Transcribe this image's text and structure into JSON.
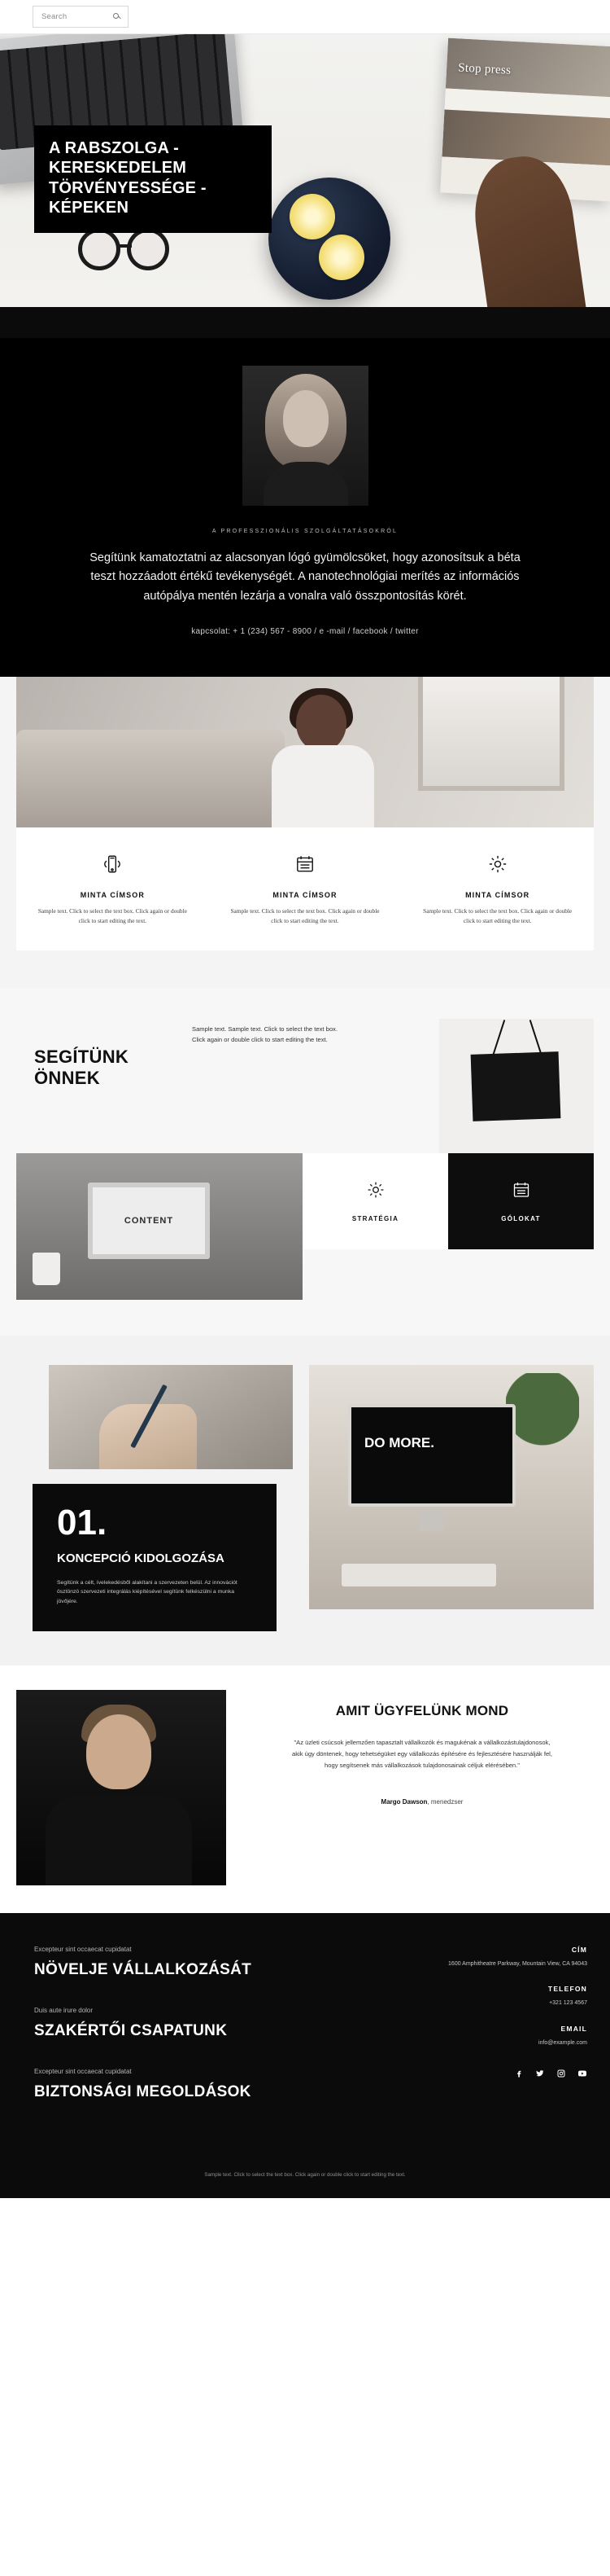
{
  "topbar": {
    "search_placeholder": "Search"
  },
  "hero": {
    "title": "A RABSZOLGA - KERESKEDELEM TÖRVÉNYESSÉGE - KÉPEKEN",
    "magazine_text": "Stop press"
  },
  "intro": {
    "eyebrow": "A PROFESSZIONÁLIS SZOLGÁLTATÁSOKRÓL",
    "lead": "Segítünk kamatoztatni az alacsonyan lógó gyümölcsöket, hogy azonosítsuk a béta teszt hozzáadott értékű tevékenységét. A nanotechnológiai merítés az információs autópálya mentén lezárja a vonalra való összpontosítás körét.",
    "contact": "kapcsolat: + 1 (234) 567 - 8900 / e -mail / facebook / twitter"
  },
  "features": {
    "cards": [
      {
        "icon": "mobile-signal-icon",
        "title": "MINTA CÍMSOR",
        "text": "Sample text. Click to select the text box. Click again or double click to start editing the text."
      },
      {
        "icon": "calendar-icon",
        "title": "MINTA CÍMSOR",
        "text": "Sample text. Click to select the text box. Click again or double click to start editing the text."
      },
      {
        "icon": "gear-icon",
        "title": "MINTA CÍMSOR",
        "text": "Sample text. Click to select the text box. Click again or double click to start editing the text."
      }
    ]
  },
  "help": {
    "heading": "SEGÍTÜNK ÖNNEK",
    "text": "Sample text. Sample text. Click to select the text box. Click again or double click to start editing the text.",
    "laptop_screen_label": "CONTENT",
    "tiles": [
      {
        "icon": "gear-icon",
        "label": "STRATÉGIA"
      },
      {
        "icon": "calendar-icon",
        "label": "GÓLOKAT"
      }
    ]
  },
  "concept": {
    "number": "01.",
    "title": "KONCEPCIÓ KIDOLGOZÁSA",
    "text": "Segítünk a célt, ívelekedésből alakítani a szervezeten belül. Az innovációt ösztönzö szervezeti integrálás kiépítésével segítünk felkészülni a munka jövőjére.",
    "photo_text": "DO MORE."
  },
  "testimonial": {
    "heading": "AMIT ÜGYFELÜNK MOND",
    "quote": "\"Az üzleti csúcsok jellemzően tapasztalt vállalkozók és magukénak a vállalkozástulajdonosok, akik úgy döntenek, hogy tehetségüket egy vállalkozás építésére és fejlesztésére használják fel, hogy segítsenek más vállalkozások tulajdonosainak céljuk elérésében.\"",
    "author_name": "Margo Dawson",
    "author_role": ", menedzser"
  },
  "footer": {
    "blocks": [
      {
        "small": "Excepteur sint occaecat cupidatat",
        "big": "NÖVELJE VÁLLALKOZÁSÁT"
      },
      {
        "small": "Duis aute irure dolor",
        "big": "SZAKÉRTŐI CSAPATUNK"
      },
      {
        "small": "Excepteur sint occaecat cupidatat",
        "big": "BIZTONSÁGI MEGOLDÁSOK"
      }
    ],
    "contact": {
      "address_title": "CÍM",
      "address_text": "1600 Amphitheatre Parkway, Mountain View, CA 94043",
      "phone_title": "TELEFON",
      "phone_text": "+321 123 4567",
      "email_title": "EMAIL",
      "email_text": "info@example.com"
    },
    "socials": [
      "facebook-icon",
      "twitter-icon",
      "instagram-icon",
      "youtube-icon"
    ],
    "bottom_text": "Sample text. Click to select the text box. Click again or double click to start editing the text."
  }
}
